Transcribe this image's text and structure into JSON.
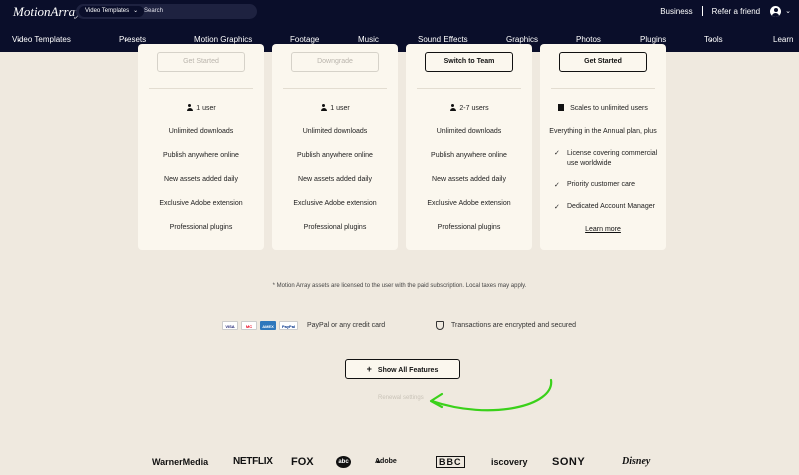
{
  "header": {
    "logo": "MotionArray",
    "search_category": "Video Templates",
    "search_placeholder": "Search",
    "business": "Business",
    "refer": "Refer a friend"
  },
  "nav": {
    "items": [
      "Video Templates",
      "Presets",
      "Motion Graphics",
      "Footage",
      "Music",
      "Sound Effects",
      "Graphics",
      "Photos",
      "Plugins",
      "Tools",
      "Learn"
    ]
  },
  "cards": [
    {
      "button": "Get Started",
      "users": "1 user",
      "features": [
        "Unlimited downloads",
        "Publish anywhere online",
        "New assets added daily",
        "Exclusive Adobe extension",
        "Professional plugins"
      ]
    },
    {
      "button": "Downgrade",
      "users": "1 user",
      "features": [
        "Unlimited downloads",
        "Publish anywhere online",
        "New assets added daily",
        "Exclusive Adobe extension",
        "Professional plugins"
      ]
    },
    {
      "button": "Switch to Team",
      "users": "2-7 users",
      "features": [
        "Unlimited downloads",
        "Publish anywhere online",
        "New assets added daily",
        "Exclusive Adobe extension",
        "Professional plugins"
      ]
    },
    {
      "button": "Get Started",
      "users": "Scales to unlimited users",
      "intro": "Everything in the Annual plan, plus",
      "features": [
        "License covering commercial use worldwide",
        "Priority customer care",
        "Dedicated Account Manager"
      ],
      "learn_more": "Learn more"
    }
  ],
  "note": "* Motion Array assets are licensed to the user with the paid subscription. Local taxes may apply.",
  "payment": {
    "cards": [
      "VISA",
      "MC",
      "AMEX",
      "PayPal"
    ],
    "text": "PayPal or any credit card",
    "secure_text": "Transactions are encrypted and secured"
  },
  "show_all": "Show All Features",
  "renewal": "Renewal settings",
  "annotation_color": "#3ad11a",
  "clients": [
    "WarnerMedia",
    "NETFLIX",
    "FOX",
    "abc",
    "Adobe",
    "BBC",
    "iscovery",
    "SONY",
    "Disney"
  ]
}
